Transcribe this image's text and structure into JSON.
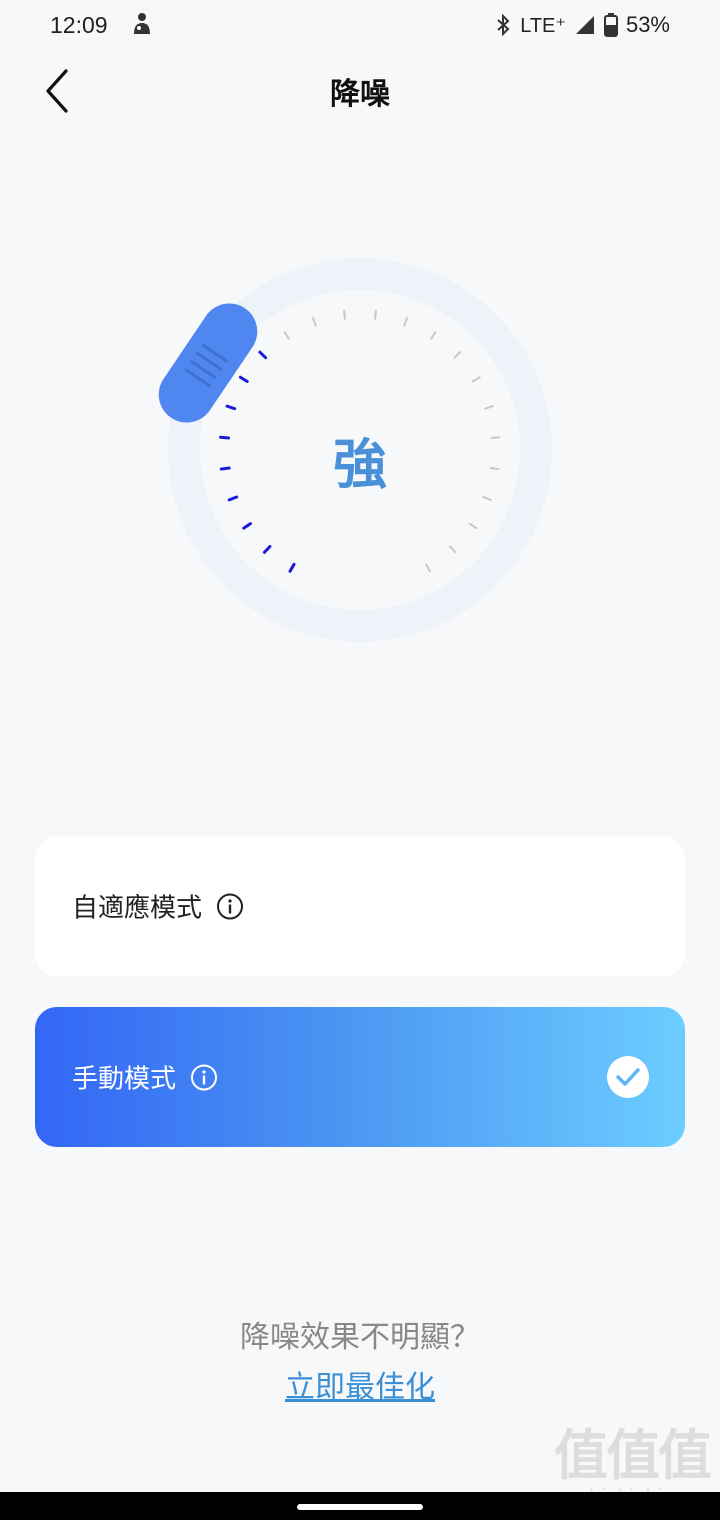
{
  "status_bar": {
    "time": "12:09",
    "network": "LTE⁺",
    "battery": "53%",
    "icons": [
      "notification-icon",
      "bluetooth-icon",
      "signal-icon",
      "battery-icon"
    ]
  },
  "header": {
    "title": "降噪",
    "back_icon": "chevron-left-icon"
  },
  "dial": {
    "level_label": "強",
    "tick_count": 24,
    "active_ticks": 9,
    "colors": {
      "active_tick": "#1a1ad6",
      "inactive_tick": "#c8c8c8",
      "ring": "#eef3f9",
      "knob": "#4f86f0",
      "level_text": "#4a90d9"
    }
  },
  "modes": [
    {
      "label": "自適應模式",
      "selected": false,
      "info_icon": "info-icon"
    },
    {
      "label": "手動模式",
      "selected": true,
      "info_icon": "info-icon",
      "check_icon": "check-circle-icon"
    }
  ],
  "footer": {
    "question": "降噪效果不明顯？",
    "link": "立即最佳化"
  },
  "watermark": {
    "logo": "值值值",
    "url": "zhizhizhi.com"
  },
  "colors": {
    "background": "#f7f8fa",
    "accent": "#3b8fd6",
    "selected_gradient_start": "#3366f5",
    "selected_gradient_end": "#6ccdff"
  }
}
